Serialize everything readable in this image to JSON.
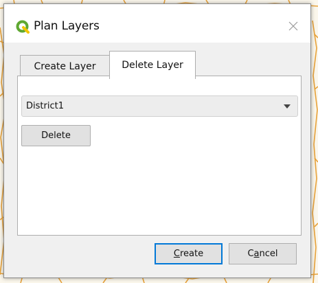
{
  "window": {
    "title": "Plan Layers"
  },
  "tabs": [
    {
      "label": "Create Layer",
      "active": false
    },
    {
      "label": "Delete Layer",
      "active": true
    }
  ],
  "delete_tab": {
    "layer_select": {
      "value": "District1"
    },
    "delete_button": "Delete"
  },
  "footer": {
    "create_button": {
      "label": "Create",
      "mnemonic": "C",
      "rest": "reate"
    },
    "cancel_button": {
      "label": "Cancel",
      "prefix": "C",
      "mnemonic": "a",
      "rest": "ncel"
    }
  },
  "colors": {
    "map_lines": "#e8a23a",
    "map_background": "#fbf7ec",
    "app_icon_green": "#5fa832",
    "default_button_border": "#0078d7"
  },
  "icons": {
    "app": "qgis-logo-icon",
    "close": "close-icon",
    "dropdown": "chevron-down-icon"
  }
}
